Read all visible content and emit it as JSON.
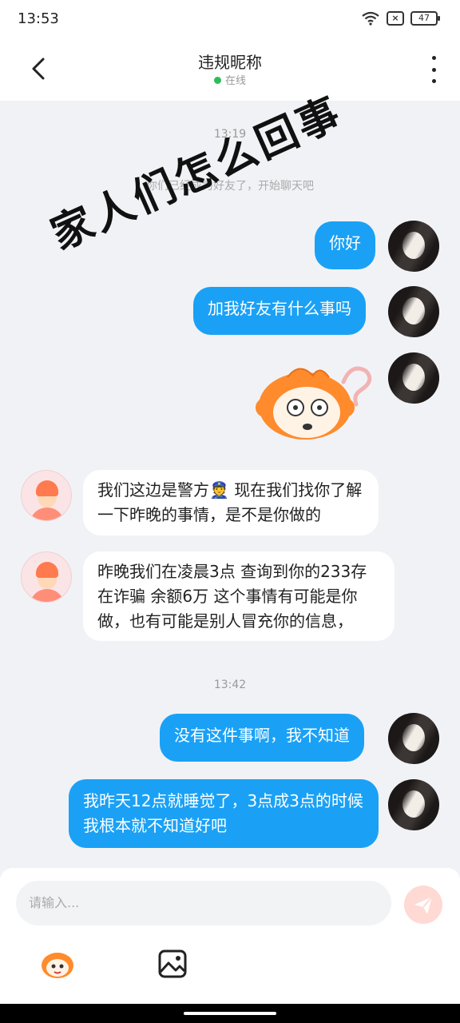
{
  "status_bar": {
    "time": "13:53",
    "battery": "47"
  },
  "header": {
    "title": "违规昵称",
    "status": "在线"
  },
  "messages": {
    "time_1": "13:19",
    "system": "你们已经成为好友了，开始聊天吧",
    "out_1": "你好",
    "out_2": "加我好友有什么事吗",
    "in_1": "我们这边是警方👮 现在我们找你了解一下昨晚的事情，是不是你做的",
    "in_2": "昨晚我们在凌晨3点 查询到你的233存在诈骗 余额6万  这个事情有可能是你做，也有可能是别人冒充你的信息，",
    "time_2": "13:42",
    "out_3": "没有这件事啊，我不知道",
    "out_4": "我昨天12点就睡觉了，3点成3点的时候我根本就不知道好吧"
  },
  "overlay": {
    "text": "家人们怎么回事"
  },
  "composer": {
    "placeholder": "请输入..."
  },
  "icons": {
    "back": "back-arrow-icon",
    "more": "more-vertical-icon",
    "send": "send-icon",
    "emoji": "emoji-sticker-icon",
    "image": "image-icon"
  },
  "colors": {
    "outgoing_bubble": "#1aa1f6",
    "online_dot": "#2ebd59",
    "send_button": "#ffd9d3"
  }
}
